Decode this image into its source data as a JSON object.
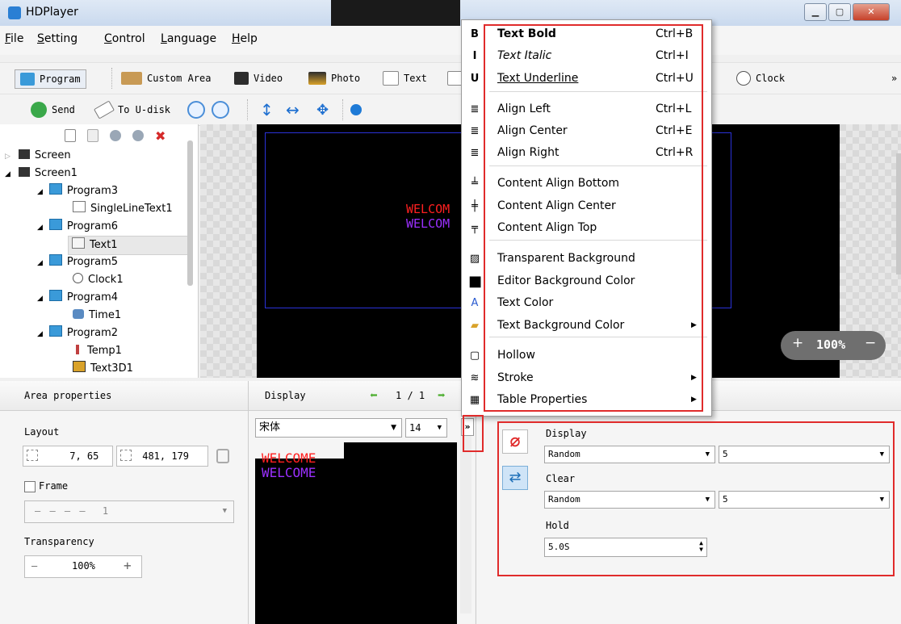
{
  "window": {
    "title": "HDPlayer"
  },
  "menubar": {
    "items": [
      "File",
      "Setting",
      "Control",
      "Language",
      "Help"
    ]
  },
  "toolbar1": {
    "program": "Program",
    "custom_area": "Custom Area",
    "video": "Video",
    "photo": "Photo",
    "text": "Text",
    "clock": "Clock",
    "more": "»"
  },
  "toolbar2": {
    "send": "Send",
    "to_udisk": "To U-disk"
  },
  "tree": {
    "items": [
      "Screen",
      "Screen1",
      "Program3",
      "SingleLineText1",
      "Program6",
      "Text1",
      "Program5",
      "Clock1",
      "Program4",
      "Time1",
      "Program2",
      "Temp1",
      "Text3D1"
    ]
  },
  "canvas": {
    "text_line1": "WELCOM",
    "text_line2": "WELCOM",
    "zoom": "100%",
    "zoom_plus": "+",
    "zoom_minus": "−"
  },
  "area_properties": {
    "header": "Area properties",
    "layout_label": "Layout",
    "position": "7, 65",
    "size": "481, 179",
    "frame_label": "Frame",
    "frame_value": "1",
    "transparency_label": "Transparency",
    "transparency_value": "100%",
    "minus": "—",
    "plus": "+"
  },
  "display_panel": {
    "header": "Display",
    "page": "1 / 1",
    "font": "宋体",
    "font_size": "14",
    "expand": "»",
    "text_line1": "WELCOME",
    "text_line2": "WELCOME"
  },
  "effects": {
    "display_label": "Display",
    "display_mode": "Random",
    "display_speed": "5",
    "clear_label": "Clear",
    "clear_mode": "Random",
    "clear_speed": "5",
    "hold_label": "Hold",
    "hold_value": "5.0S"
  },
  "context_menu": {
    "items": [
      {
        "label": "Text Bold",
        "shortcut": "Ctrl+B",
        "icon": "B"
      },
      {
        "label": "Text Italic",
        "shortcut": "Ctrl+I",
        "icon": "I"
      },
      {
        "label": "Text Underline",
        "shortcut": "Ctrl+U",
        "icon": "U"
      },
      {
        "label": "Align Left",
        "shortcut": "Ctrl+L",
        "icon": "align-left-icon"
      },
      {
        "label": "Align Center",
        "shortcut": "Ctrl+E",
        "icon": "align-center-icon"
      },
      {
        "label": "Align Right",
        "shortcut": "Ctrl+R",
        "icon": "align-right-icon"
      },
      {
        "label": "Content Align Bottom",
        "shortcut": "",
        "icon": "content-bottom-icon"
      },
      {
        "label": "Content Align Center",
        "shortcut": "",
        "icon": "content-center-icon"
      },
      {
        "label": "Content Align Top",
        "shortcut": "",
        "icon": "content-top-icon"
      },
      {
        "label": "Transparent Background",
        "shortcut": "",
        "icon": "transparent-icon"
      },
      {
        "label": "Editor Background Color",
        "shortcut": "",
        "icon": "bg-color-icon"
      },
      {
        "label": "Text Color",
        "shortcut": "",
        "icon": "text-color-icon"
      },
      {
        "label": "Text Background Color",
        "shortcut": "",
        "icon": "text-bg-icon"
      },
      {
        "label": "Hollow",
        "shortcut": "",
        "icon": "hollow-icon"
      },
      {
        "label": "Stroke",
        "shortcut": "",
        "icon": "stroke-icon"
      },
      {
        "label": "Table Properties",
        "shortcut": "",
        "icon": "table-icon"
      }
    ]
  },
  "colors": {
    "accent_red": "#e02b2b",
    "text_red": "#ff2020",
    "text_purple": "#9b30ff"
  }
}
